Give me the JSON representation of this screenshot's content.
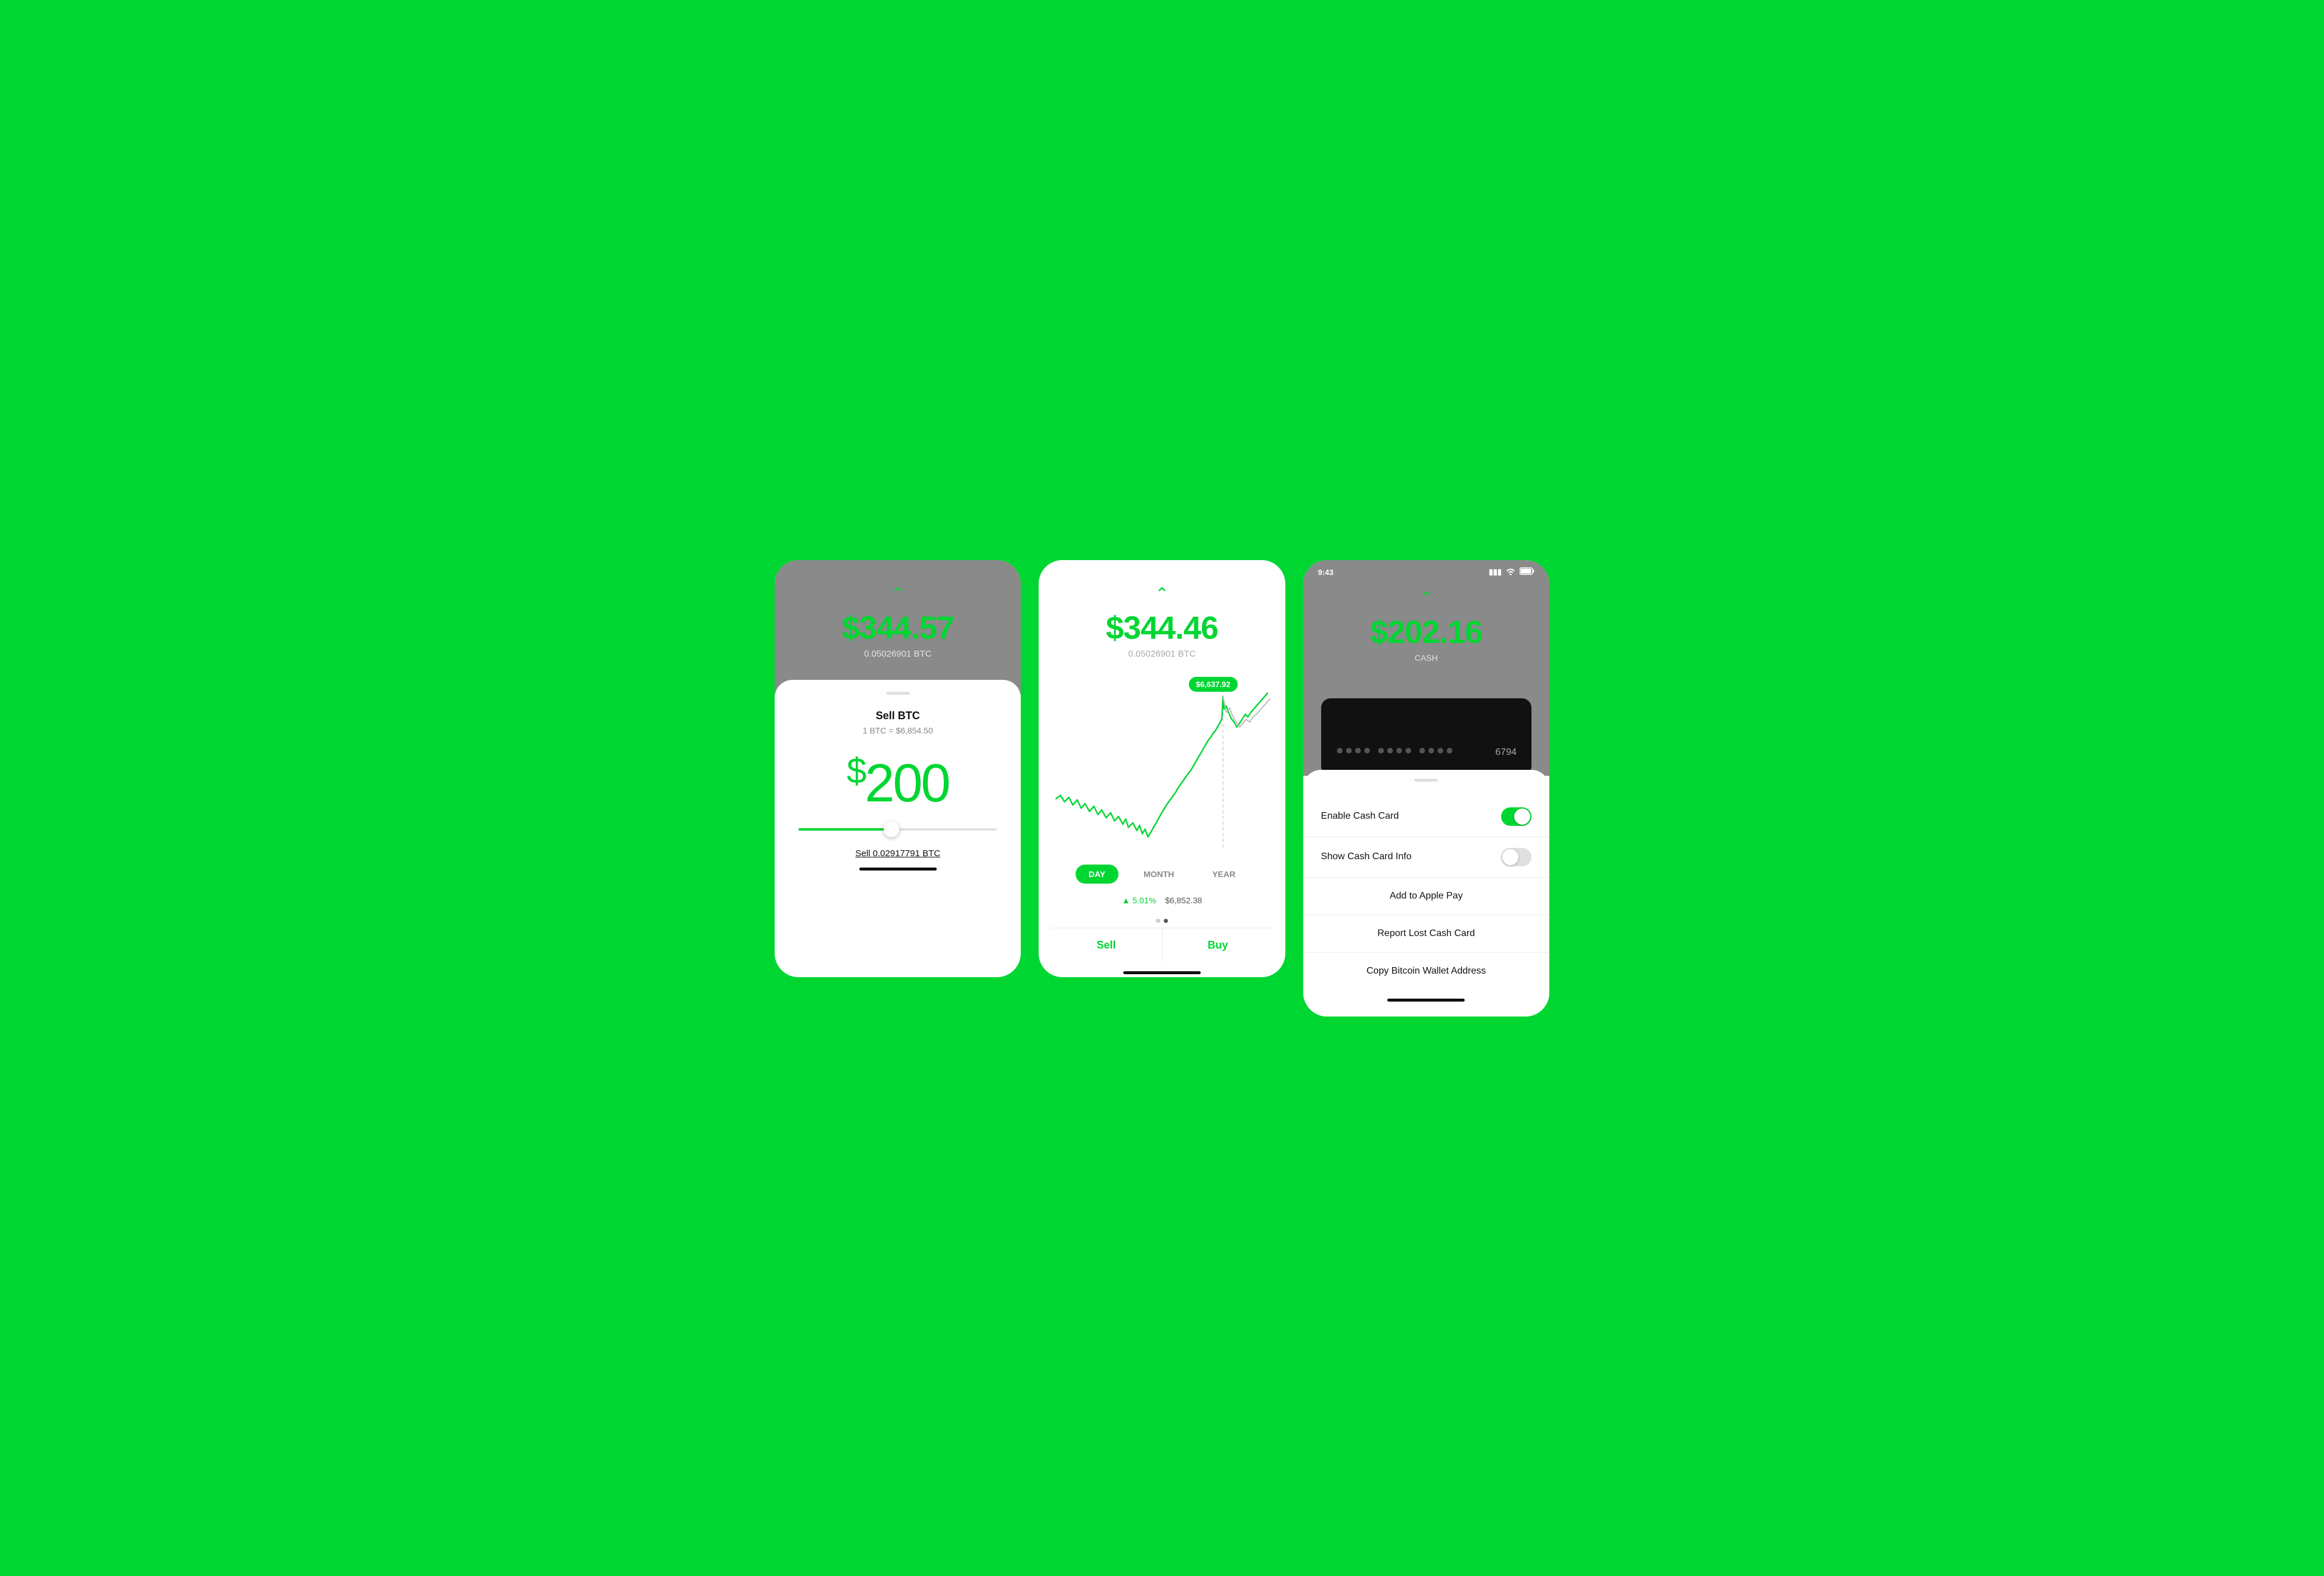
{
  "background_color": "#00d632",
  "screen1": {
    "btc_price": "$344.57",
    "btc_amount": "0.05026901 BTC",
    "sheet": {
      "handle": true,
      "sell_title": "Sell BTC",
      "sell_rate": "1 BTC = $6,854.50",
      "sell_amount_symbol": "$",
      "sell_amount": "200",
      "sell_btc_label": "Sell 0.02917791 BTC"
    }
  },
  "screen2": {
    "btc_price": "$344.46",
    "btc_amount": "0.05026901 BTC",
    "chart_tooltip": "$6,637.92",
    "time_options": [
      {
        "label": "DAY",
        "active": true
      },
      {
        "label": "MONTH",
        "active": false
      },
      {
        "label": "YEAR",
        "active": false
      }
    ],
    "stats": {
      "change": "▲ 5.01%",
      "price": "$6,852.38"
    },
    "actions": {
      "sell": "Sell",
      "buy": "Buy"
    }
  },
  "screen3": {
    "status_bar": {
      "time": "9:43",
      "signal": "●●●",
      "wifi": "wifi",
      "battery": "battery"
    },
    "cash_balance": "$202.16",
    "cash_label": "CASH",
    "card": {
      "dots": "●●●●    ●●●●    ●●●●",
      "last4": "6794"
    },
    "settings": [
      {
        "label": "Enable Cash Card",
        "type": "toggle",
        "value": true
      },
      {
        "label": "Show Cash Card Info",
        "type": "toggle",
        "value": false
      }
    ],
    "menu_items": [
      "Add to Apple Pay",
      "Report Lost Cash Card",
      "Copy Bitcoin Wallet Address"
    ]
  },
  "icons": {
    "chevron_up": "˄",
    "arrow_up_circle": "⊙"
  }
}
